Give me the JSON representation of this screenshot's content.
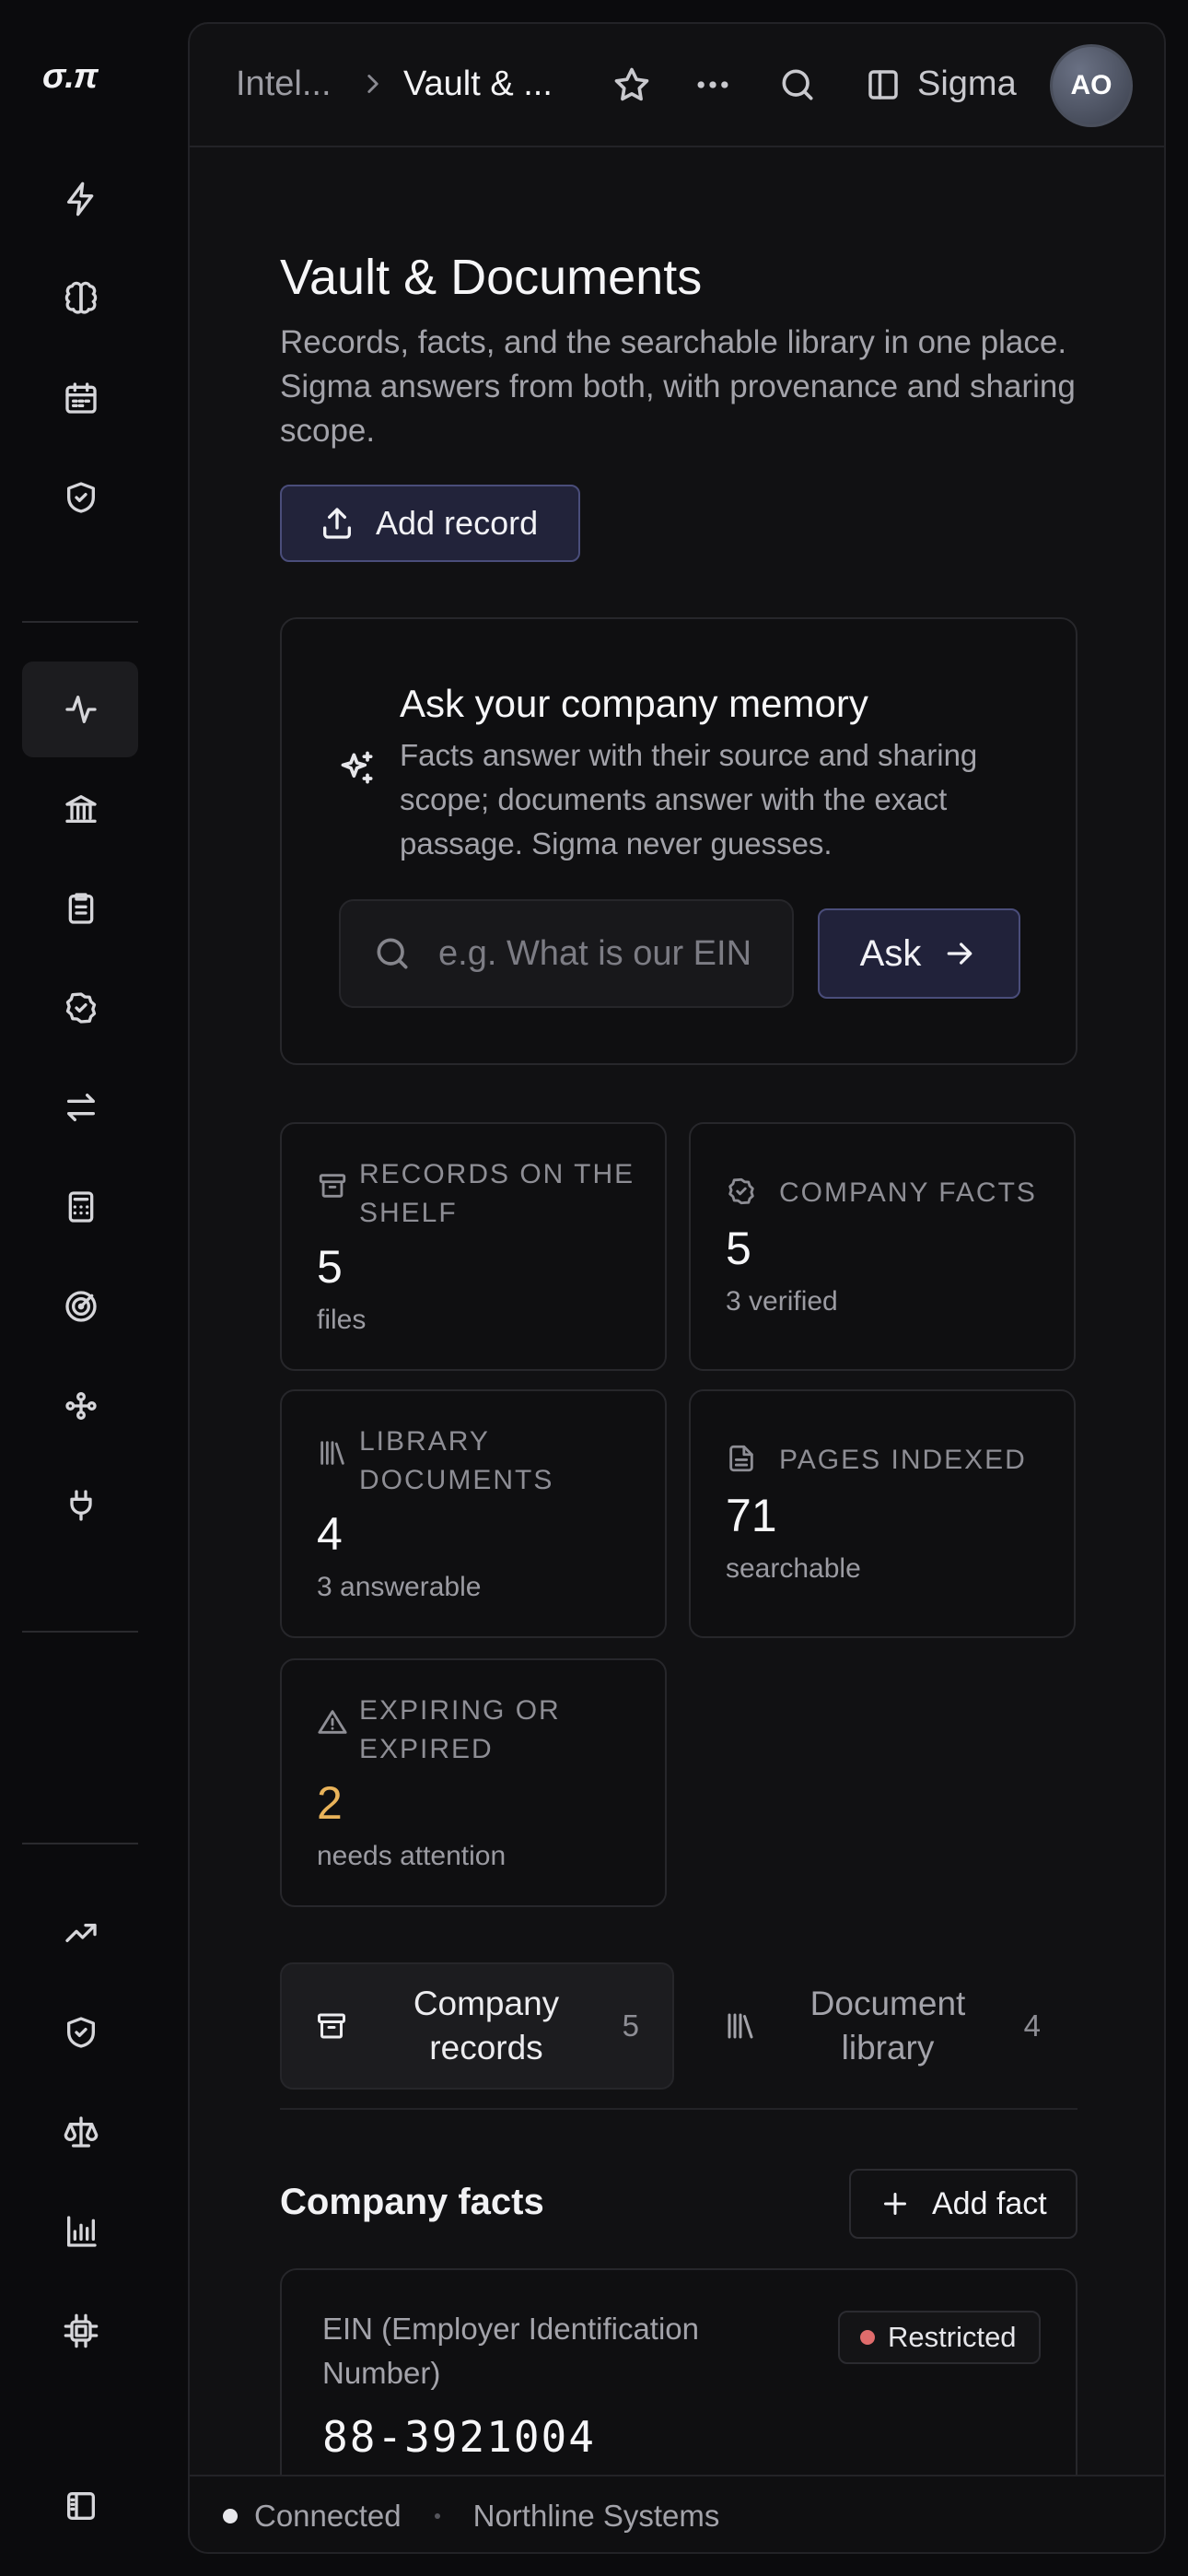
{
  "rail": {
    "logo": "σ.π",
    "items": [
      {
        "name": "bolt-icon"
      },
      {
        "name": "brain-icon"
      },
      {
        "name": "calendar-icon"
      },
      {
        "name": "shield-check-icon"
      },
      {
        "name": "activity-icon",
        "active": true
      },
      {
        "name": "bank-icon"
      },
      {
        "name": "clipboard-icon"
      },
      {
        "name": "badge-check-icon"
      },
      {
        "name": "arrows-exchange-icon"
      },
      {
        "name": "calculator-icon"
      },
      {
        "name": "target-icon"
      },
      {
        "name": "workflow-icon"
      },
      {
        "name": "plug-icon"
      },
      {
        "name": "trending-up-icon"
      },
      {
        "name": "shield-check-icon"
      },
      {
        "name": "scale-icon"
      },
      {
        "name": "bar-chart-icon"
      },
      {
        "name": "chip-icon"
      },
      {
        "name": "sidebar-toggle-icon"
      }
    ]
  },
  "topbar": {
    "breadcrumb_parent": "Intel...",
    "breadcrumb_current": "Vault & ...",
    "sigma_label": "Sigma",
    "avatar_initials": "AO"
  },
  "page": {
    "title": "Vault & Documents",
    "description": "Records, facts, and the searchable library in one place. Sigma answers from both, with provenance and sharing scope.",
    "add_record_label": "Add record"
  },
  "ask": {
    "title": "Ask your company memory",
    "description": "Facts answer with their source and sharing scope; documents answer with the exact passage. Sigma never guesses.",
    "placeholder": "e.g. What is our EIN?",
    "button_label": "Ask"
  },
  "stats": {
    "records": {
      "label": "Records on the shelf",
      "value": "5",
      "sub": "files"
    },
    "facts": {
      "label": "Company facts",
      "value": "5",
      "sub": "3 verified"
    },
    "library": {
      "label": "Library documents",
      "value": "4",
      "sub": "3 answerable"
    },
    "pages": {
      "label": "Pages indexed",
      "value": "71",
      "sub": "searchable"
    },
    "expiring": {
      "label": "Expiring or expired",
      "value": "2",
      "sub": "needs attention",
      "value_color": "#e9b35a"
    }
  },
  "tabs": {
    "records": {
      "label": "Company records",
      "count": "5"
    },
    "library": {
      "label": "Document library",
      "count": "4"
    }
  },
  "facts_section": {
    "title": "Company facts",
    "add_label": "Add fact",
    "items": [
      {
        "label": "EIN (Employer Identification Number)",
        "value": "88-3921004",
        "badge": "Restricted",
        "badge_color": "#e06c6c"
      }
    ]
  },
  "status": {
    "connection": "Connected",
    "org": "Northline Systems"
  }
}
